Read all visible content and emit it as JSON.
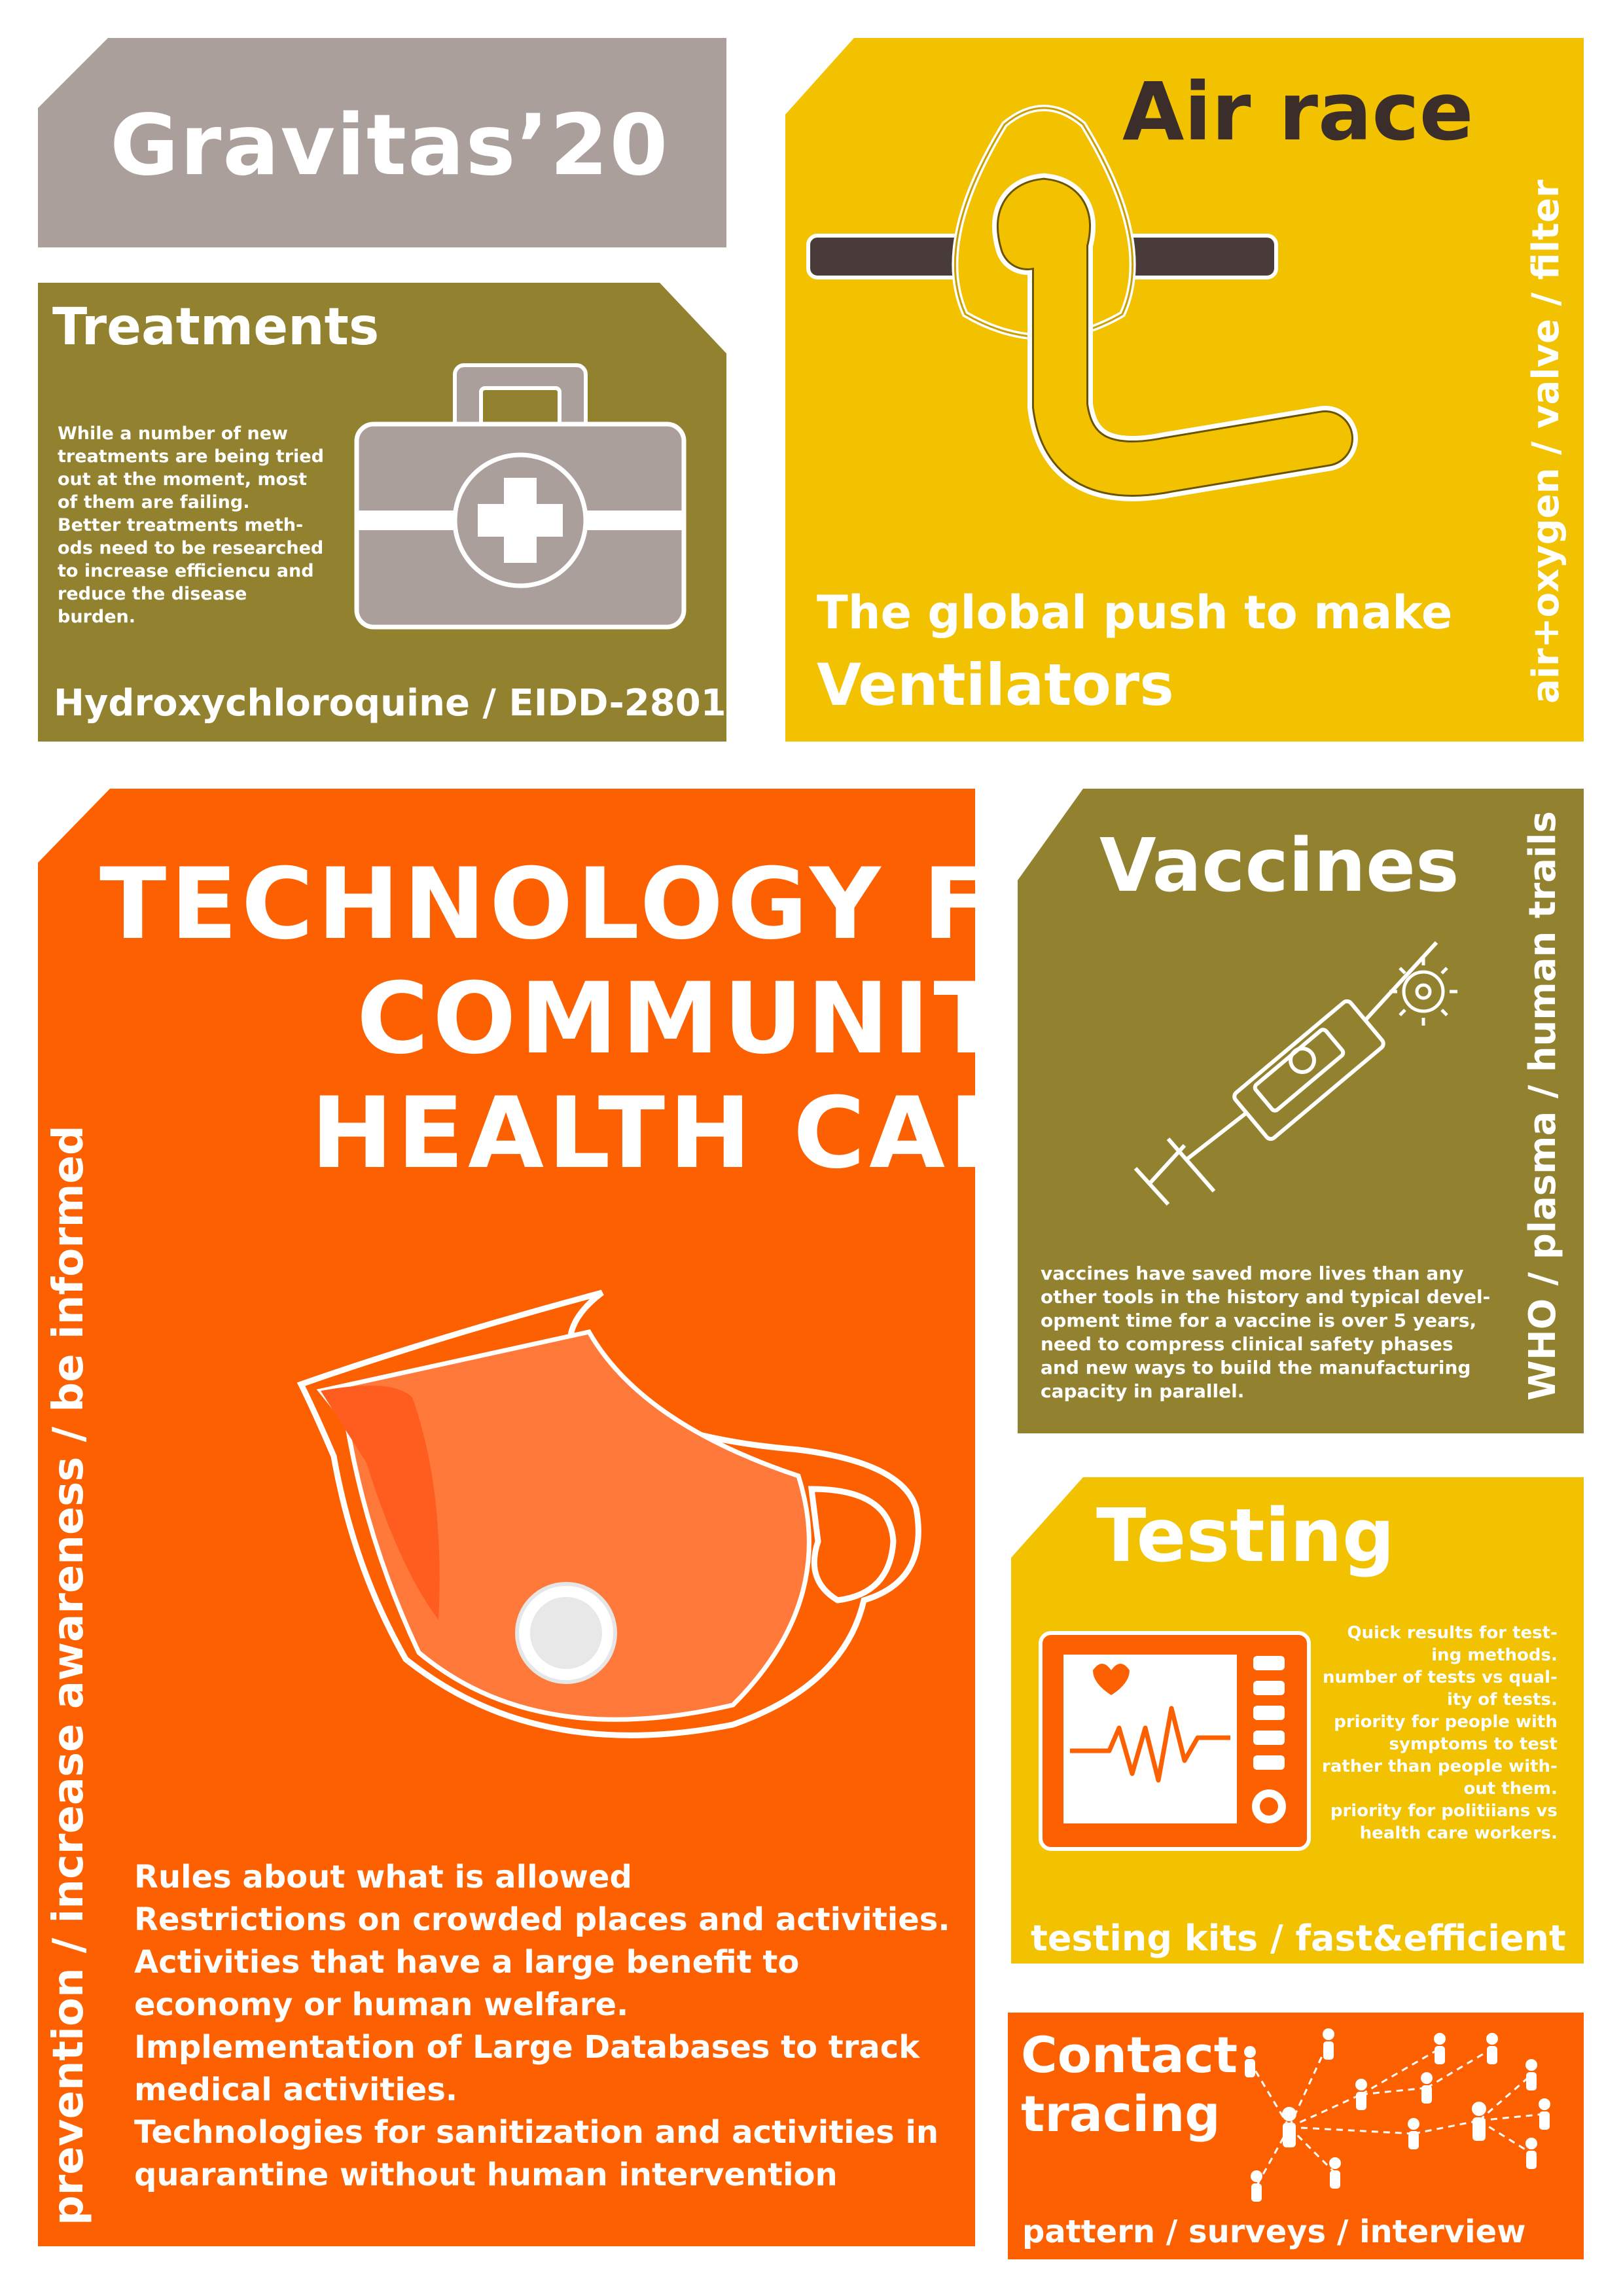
{
  "colors": {
    "gray": "#ab9f9c",
    "olive": "#928230",
    "yellow": "#f2c200",
    "orange": "#fd6000",
    "dark_text": "#3b2e2a",
    "white": "#ffffff"
  },
  "header": {
    "title": "Gravitas’20"
  },
  "treatments": {
    "title": "Treatments",
    "body": "While a number of new\ntreatments are being tried\nout at the moment, most\nof them are failing.\nBetter treatments meth-\nods need to be researched\nto increase efficiencu and\nreduce the disease\nburden.",
    "footer": "Hydroxychloroquine / EIDD-2801",
    "icon": "first-aid-kit-icon"
  },
  "air_race": {
    "title": "Air race",
    "subtitle": "The global push to make",
    "highlight": "Ventilators",
    "side": "air+oxygen / valve / filter",
    "icon": "oxygen-mask-icon"
  },
  "main": {
    "title_lines": [
      "TECHNOLOGY FOR",
      "COMMUNITY",
      "HEALTH CARE"
    ],
    "side": "prevention / increase awareness / be informed",
    "icon": "face-mask-icon",
    "items": [
      "Rules about what is allowed",
      "Restrictions on crowded places and activities.",
      "Activities that have a large benefit to",
      "economy or human welfare.",
      "Implementation of Large Databases to track",
      "medical activities.",
      "Technologies for sanitization and activities in",
      "quarantine without human intervention"
    ]
  },
  "vaccines": {
    "title": "Vaccines",
    "body": "vaccines have saved more lives than any\nother tools in the history and typical devel-\nopment time for a vaccine is over 5 years,\nneed to compress clinical safety phases\nand new ways to build the manufacturing\ncapacity in parallel.",
    "side": "WHO / plasma / human trails",
    "icon": "syringe-icon"
  },
  "testing": {
    "title": "Testing",
    "body": "Quick results for test-\ning methods.\nnumber of tests vs qual-\nity of tests.\npriority for people with\nsymptoms to test\nrather than people with-\nout them.\npriority for politiians vs\nhealth care workers.",
    "footer": "testing kits / fast&efficient",
    "icon": "heart-monitor-icon"
  },
  "contact": {
    "title_lines": [
      "Contact",
      "tracing"
    ],
    "footer": "pattern / surveys / interview",
    "icon": "network-people-icon"
  }
}
